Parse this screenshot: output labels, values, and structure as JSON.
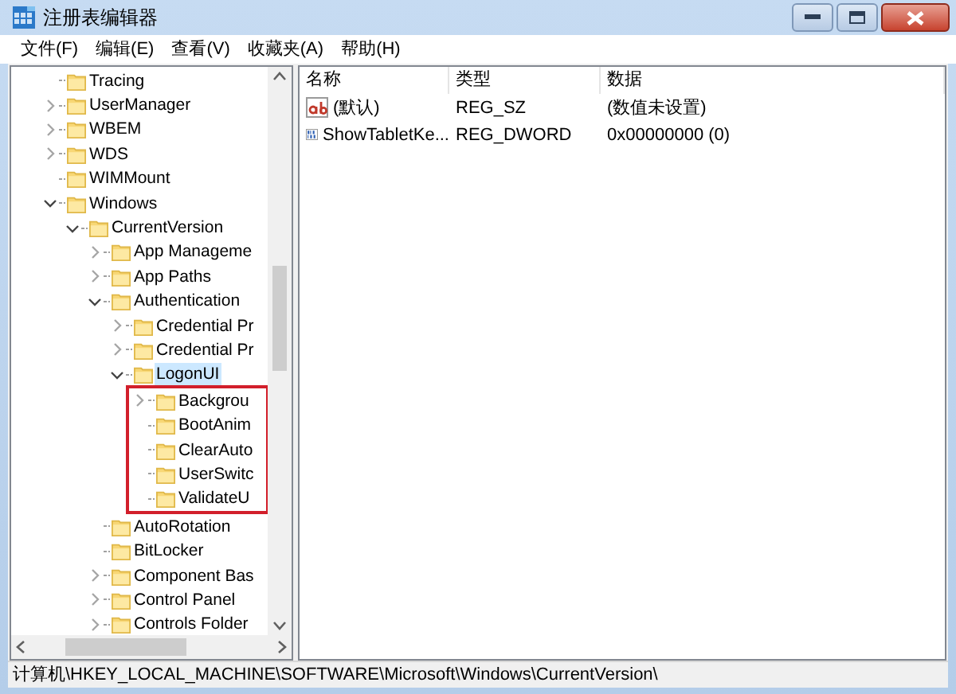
{
  "window": {
    "title": "注册表编辑器"
  },
  "menu": [
    "文件(F)",
    "编辑(E)",
    "查看(V)",
    "收藏夹(A)",
    "帮助(H)"
  ],
  "tree": [
    {
      "label": "Tracing",
      "selected": false
    },
    {
      "label": "UserManager",
      "expanded": false,
      "selected": false
    },
    {
      "label": "WBEM",
      "expanded": false,
      "selected": false
    },
    {
      "label": "WDS",
      "expanded": false,
      "selected": false
    },
    {
      "label": "WIMMount",
      "selected": false
    },
    {
      "label": "Windows",
      "expanded": true,
      "selected": false,
      "children": [
        {
          "label": "CurrentVersion",
          "expanded": true,
          "selected": false,
          "children": [
            {
              "label": "App Manageme",
              "expanded": false,
              "selected": false
            },
            {
              "label": "App Paths",
              "expanded": false,
              "selected": false
            },
            {
              "label": "Authentication",
              "expanded": true,
              "selected": false,
              "children": [
                {
                  "label": "Credential Pr",
                  "expanded": false,
                  "selected": false
                },
                {
                  "label": "Credential Pr",
                  "expanded": false,
                  "selected": false
                },
                {
                  "label": "LogonUI",
                  "expanded": true,
                  "selected": true,
                  "outline_children": true,
                  "children": [
                    {
                      "label": "Backgrou",
                      "expanded": false,
                      "selected": false
                    },
                    {
                      "label": "BootAnim",
                      "selected": false
                    },
                    {
                      "label": "ClearAuto",
                      "selected": false
                    },
                    {
                      "label": "UserSwitc",
                      "selected": false
                    },
                    {
                      "label": "ValidateU",
                      "selected": false
                    }
                  ]
                }
              ]
            },
            {
              "label": "AutoRotation",
              "selected": false
            },
            {
              "label": "BitLocker",
              "selected": false
            },
            {
              "label": "Component Bas",
              "expanded": false,
              "selected": false
            },
            {
              "label": "Control Panel",
              "expanded": false,
              "selected": false
            },
            {
              "label": "Controls Folder",
              "expanded": false,
              "selected": false
            }
          ]
        }
      ]
    }
  ],
  "values": {
    "columns": [
      "名称",
      "类型",
      "数据"
    ],
    "rows": [
      {
        "kind": "string",
        "name": "(默认)",
        "type": "REG_SZ",
        "data": "(数值未设置)"
      },
      {
        "kind": "dword",
        "name": "ShowTabletKe...",
        "type": "REG_DWORD",
        "data": "0x00000000 (0)"
      }
    ]
  },
  "status_bar": "计算机\\HKEY_LOCAL_MACHINE\\SOFTWARE\\Microsoft\\Windows\\CurrentVersion\\"
}
